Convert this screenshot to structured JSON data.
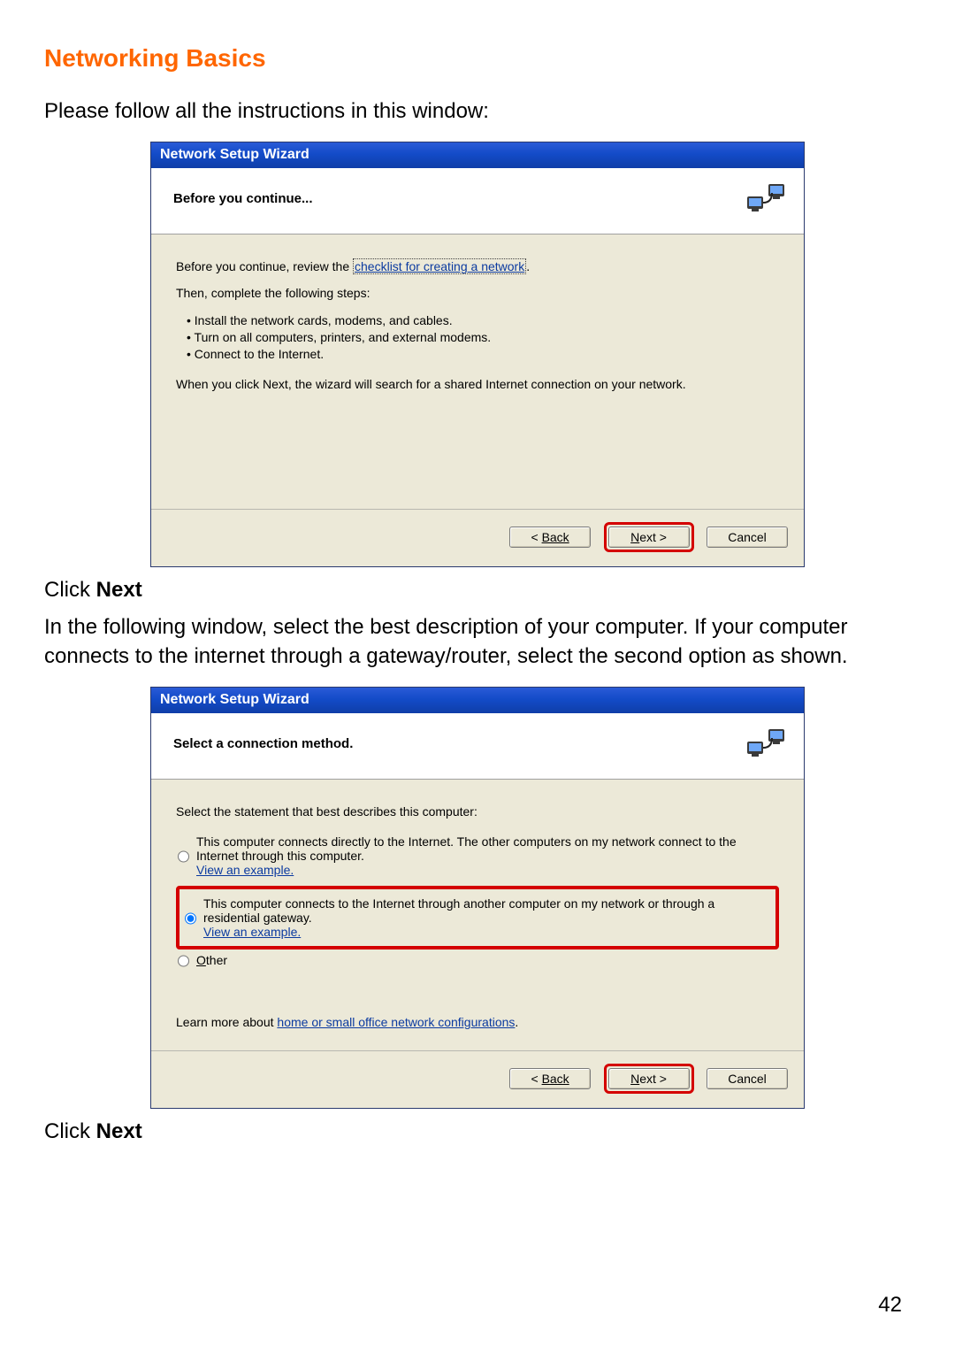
{
  "doc": {
    "heading": "Networking Basics",
    "intro": "Please follow all the instructions in this window:",
    "click_next_prefix": "Click ",
    "click_next_bold": "Next",
    "para2": "In the following window, select the best description of your computer.  If your computer connects to the internet through a gateway/router, select the second option as shown.",
    "page_number": "42"
  },
  "wizard1": {
    "title": "Network Setup Wizard",
    "subtitle": "Before you continue...",
    "line_before": "Before you continue, review the ",
    "checklist_link": "checklist for creating a network",
    "line_then": "Then, complete the following steps:",
    "steps": [
      "Install the network cards, modems, and cables.",
      "Turn on all computers, printers, and external modems.",
      "Connect to the Internet."
    ],
    "line_after": "When you click Next, the wizard will search for a shared Internet connection on your network.",
    "buttons": {
      "back": "Back",
      "next": "Next >",
      "cancel": "Cancel"
    }
  },
  "wizard2": {
    "title": "Network Setup Wizard",
    "subtitle": "Select a connection method.",
    "prompt": "Select the statement that best describes this computer:",
    "options": [
      {
        "label": "This computer connects directly to the Internet. The other computers on my network connect to the Internet through this computer.",
        "example": "View an example.",
        "selected": false,
        "highlighted": false
      },
      {
        "label": "This computer connects to the Internet through another computer on my network or through a residential gateway.",
        "example": "View an example.",
        "selected": true,
        "highlighted": true
      },
      {
        "label": "Other",
        "example": "",
        "selected": false,
        "highlighted": false
      }
    ],
    "learn_prefix": "Learn more about ",
    "learn_link": "home or small office network configurations",
    "buttons": {
      "back": "Back",
      "next": "Next >",
      "cancel": "Cancel"
    }
  }
}
